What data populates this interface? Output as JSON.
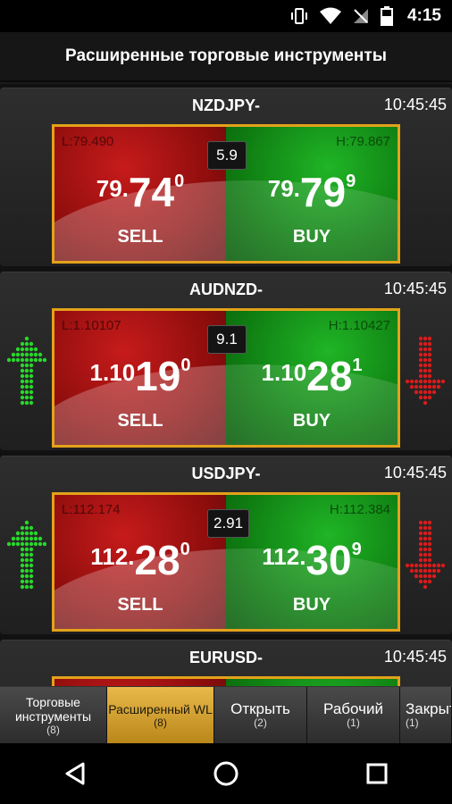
{
  "status": {
    "time": "4:15"
  },
  "header": {
    "title": "Расширенные торговые инструменты"
  },
  "instruments": [
    {
      "symbol": "NZDJPY-",
      "time": "10:45:45",
      "low": "L:79.490",
      "high": "H:79.867",
      "spread": "5.9",
      "sell": {
        "small": "79.",
        "big": "74",
        "sup": "0"
      },
      "buy": {
        "small": "79.",
        "big": "79",
        "sup": "9"
      },
      "sell_label": "SELL",
      "buy_label": "BUY",
      "trend": "none"
    },
    {
      "symbol": "AUDNZD-",
      "time": "10:45:45",
      "low": "L:1.10107",
      "high": "H:1.10427",
      "spread": "9.1",
      "sell": {
        "small": "1.10",
        "big": "19",
        "sup": "0"
      },
      "buy": {
        "small": "1.10",
        "big": "28",
        "sup": "1"
      },
      "sell_label": "SELL",
      "buy_label": "BUY",
      "trend": "both"
    },
    {
      "symbol": "USDJPY-",
      "time": "10:45:45",
      "low": "L:112.174",
      "high": "H:112.384",
      "spread": "2.91",
      "sell": {
        "small": "112.",
        "big": "28",
        "sup": "0"
      },
      "buy": {
        "small": "112.",
        "big": "30",
        "sup": "9"
      },
      "sell_label": "SELL",
      "buy_label": "BUY",
      "trend": "both"
    },
    {
      "symbol": "EURUSD-",
      "time": "10:45:45"
    }
  ],
  "tabs": [
    {
      "label": "Торговые инструменты",
      "count": "(8)"
    },
    {
      "label": "Расширенный WL",
      "count": "(8)"
    },
    {
      "label": "Открыть",
      "count": "(2)"
    },
    {
      "label": "Рабочий",
      "count": "(1)"
    },
    {
      "label": "Закрытые",
      "count": "(1)"
    }
  ],
  "colors": {
    "accent": "#e3a21a",
    "sell": "#b51414",
    "buy": "#14a31a",
    "up_arrow": "#27d82b",
    "down_arrow": "#d81b1b"
  },
  "icons": {
    "vibrate": "vibrate-icon",
    "wifi": "wifi-icon",
    "no_sim": "no-sim-icon",
    "battery": "battery-icon",
    "back": "back-icon",
    "home": "home-icon",
    "recents": "recents-icon",
    "up": "dotted-up-arrow-icon",
    "down": "dotted-down-arrow-icon"
  }
}
